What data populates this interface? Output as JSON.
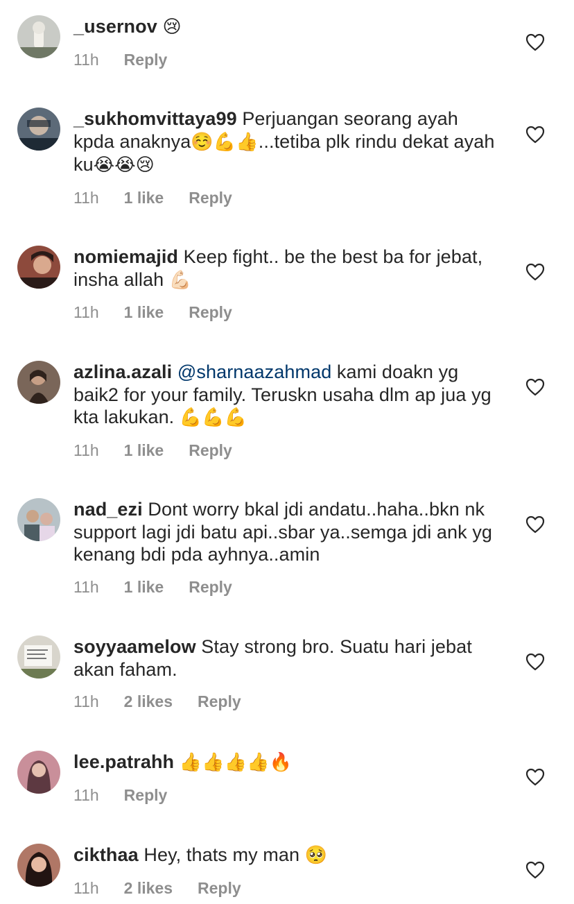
{
  "comments": [
    {
      "username": "_usernov",
      "pre": "",
      "mention": "",
      "text": " ",
      "emoji": "😢",
      "time": "11h",
      "likes": "",
      "reply": "Reply",
      "avatar_colors": [
        "#c9cbc6",
        "#6f7865"
      ]
    },
    {
      "username": "_sukhomvittaya99",
      "pre": " Perjuangan seorang ayah kpda anaknya",
      "mention": "",
      "text": "",
      "emoji": "☺️💪👍",
      "post": "...tetiba plk rindu dekat ayah ku",
      "emoji2": "😭😭😢",
      "time": "11h",
      "likes": "1 like",
      "reply": "Reply",
      "avatar_colors": [
        "#5c6a78",
        "#1e2a35"
      ]
    },
    {
      "username": "nomiemajid",
      "pre": " Keep fight.. be the best ba for jebat, insha allah ",
      "mention": "",
      "text": "",
      "emoji": "💪🏻",
      "time": "11h",
      "likes": "1 like",
      "reply": "Reply",
      "avatar_colors": [
        "#8d4a3c",
        "#2a1b18"
      ]
    },
    {
      "username": "azlina.azali",
      "pre": " ",
      "mention": "@sharnaazahmad",
      "text": " kami doakn yg baik2 for your family. Teruskn usaha dlm ap jua yg kta lakukan. ",
      "emoji": "💪💪💪",
      "time": "11h",
      "likes": "1 like",
      "reply": "Reply",
      "avatar_colors": [
        "#7a6659",
        "#2f221c"
      ]
    },
    {
      "username": "nad_ezi",
      "pre": " Dont worry bkal jdi andatu..haha..bkn nk support lagi jdi batu api..sbar ya..semga jdi ank yg kenang bdi pda ayhnya..amin",
      "mention": "",
      "text": "",
      "emoji": "",
      "time": "11h",
      "likes": "1 like",
      "reply": "Reply",
      "avatar_colors": [
        "#b7c2c7",
        "#4d5d63"
      ]
    },
    {
      "username": "soyyaamelow",
      "pre": " Stay strong bro. Suatu hari jebat akan faham.",
      "mention": "",
      "text": "",
      "emoji": "",
      "time": "11h",
      "likes": "2 likes",
      "reply": "Reply",
      "avatar_colors": [
        "#d8d5cc",
        "#6d7b52"
      ]
    },
    {
      "username": "lee.patrahh",
      "pre": " ",
      "mention": "",
      "text": "",
      "emoji": "👍👍👍👍🔥",
      "time": "11h",
      "likes": "",
      "reply": "Reply",
      "avatar_colors": [
        "#c98f9a",
        "#4a2a31"
      ]
    },
    {
      "username": "cikthaa",
      "pre": " Hey, thats my man ",
      "mention": "",
      "text": "",
      "emoji": "🥺",
      "time": "11h",
      "likes": "2 likes",
      "reply": "Reply",
      "avatar_colors": [
        "#b07766",
        "#221412"
      ]
    }
  ]
}
